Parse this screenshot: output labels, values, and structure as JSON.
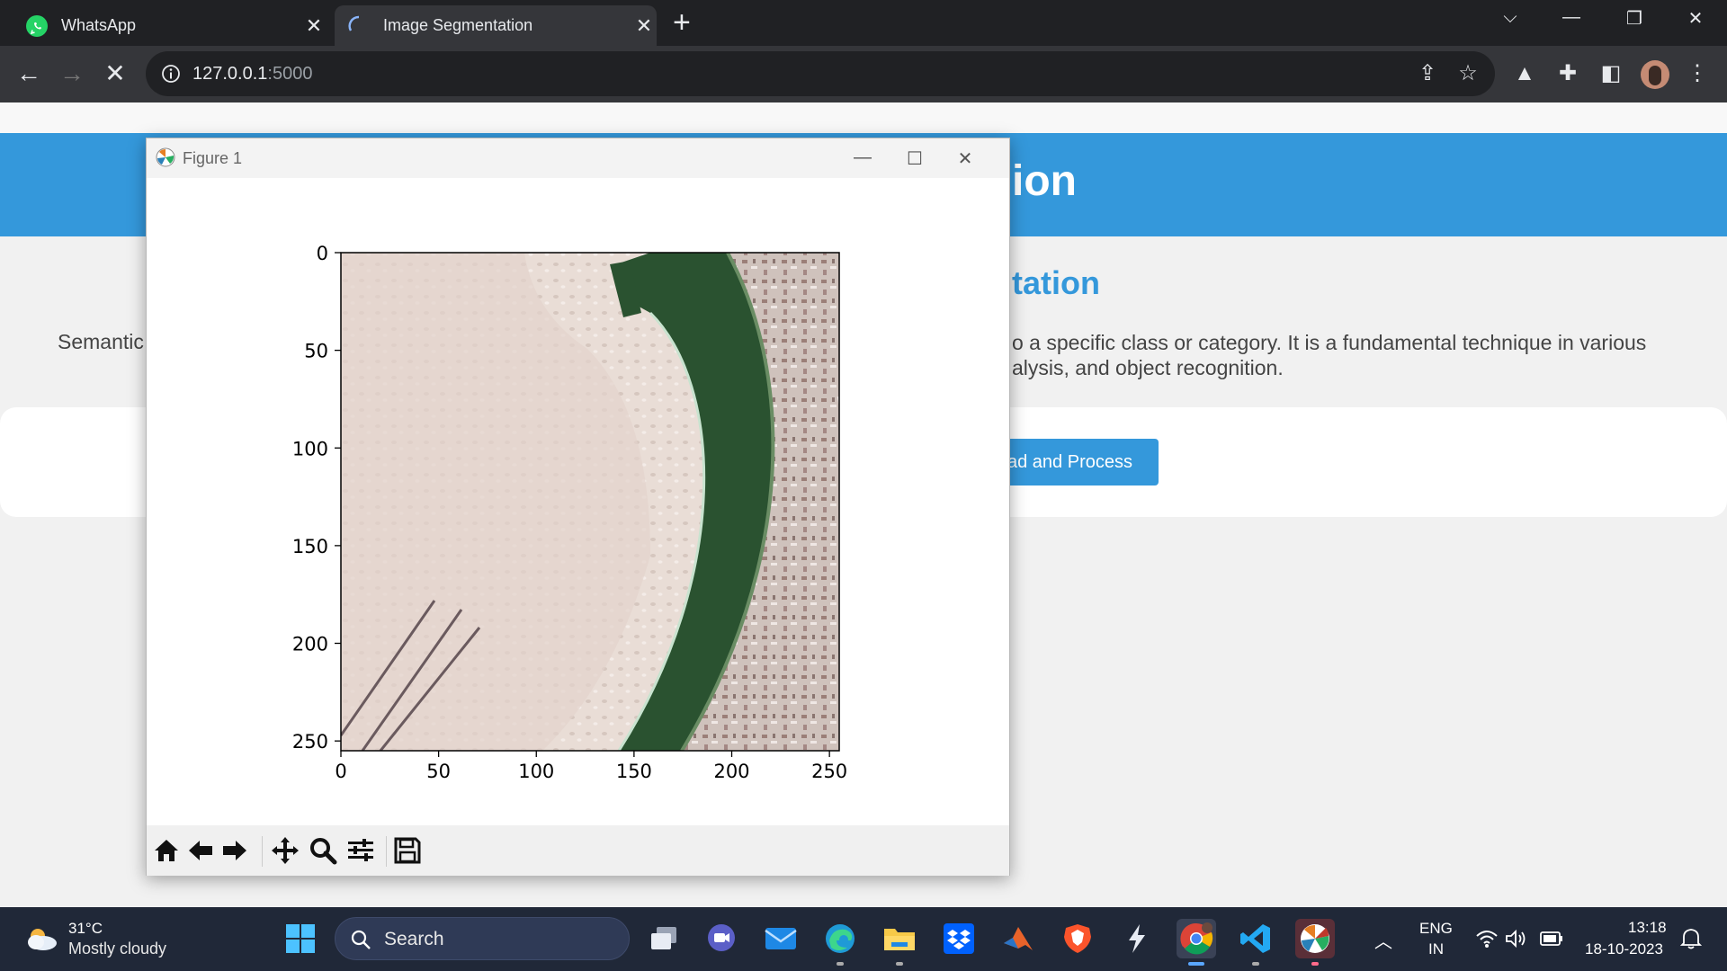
{
  "browser": {
    "tabs": [
      {
        "title": "WhatsApp",
        "icon": "whatsapp-icon"
      },
      {
        "title": "Image Segmentation",
        "icon": "loading-spinner-icon",
        "active": true
      }
    ],
    "url_host": "127.0.0.1",
    "url_port": ":5000"
  },
  "page": {
    "banner_title_visible": "ion",
    "subtitle_visible": "tation",
    "desc_left_visible": "Semantic",
    "desc_right_line1": "o a specific class or category. It is a fundamental technique in various",
    "desc_right_line2": "alysis, and object recognition.",
    "upload_button_visible": "ad and Process",
    "accent_color": "#3498db"
  },
  "figure": {
    "window_title": "Figure 1",
    "plot": {
      "type": "image",
      "x_ticks": [
        "0",
        "50",
        "100",
        "150",
        "200",
        "250"
      ],
      "y_ticks": [
        "0",
        "50",
        "100",
        "150",
        "200",
        "250"
      ],
      "xlim": [
        0,
        255
      ],
      "ylim": [
        255,
        0
      ]
    },
    "toolbar_icons": [
      "home-icon",
      "back-icon",
      "forward-icon",
      "pan-icon",
      "zoom-icon",
      "configure-subplots-icon",
      "save-icon"
    ]
  },
  "taskbar": {
    "weather_temp": "31°C",
    "weather_desc": "Mostly cloudy",
    "search_placeholder": "Search",
    "lang_line1": "ENG",
    "lang_line2": "IN",
    "time": "13:18",
    "date": "18-10-2023"
  }
}
